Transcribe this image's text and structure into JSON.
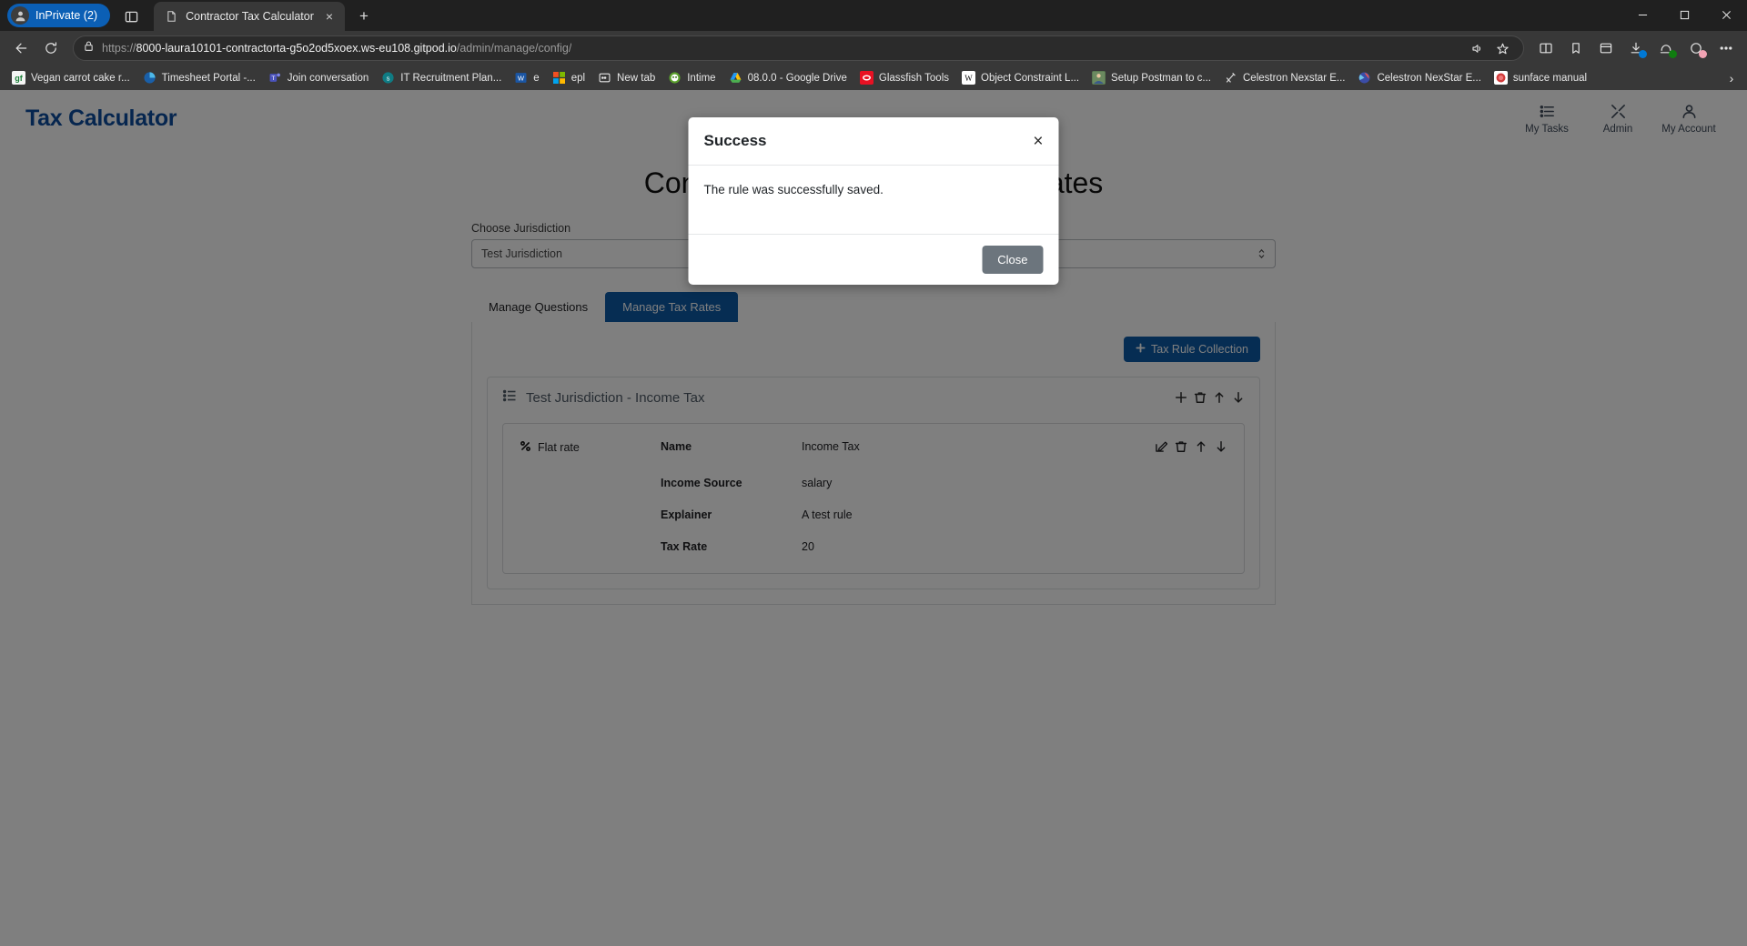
{
  "browser": {
    "profile_pill": "InPrivate (2)",
    "tab": {
      "title": "Contractor Tax Calculator",
      "close_label": "×"
    },
    "new_tab_label": "+",
    "url": {
      "scheme": "https://",
      "host": "8000-laura10101-contractorta-g5o2od5xoex.ws-eu108.gitpod.io",
      "path": "/admin/manage/config/"
    },
    "window_controls": {
      "minimize": "—",
      "maximize": "□",
      "close": "×"
    },
    "bookmarks": [
      {
        "label": "Vegan carrot cake r...",
        "icon": "gf-icon",
        "color": "#f5f5f5",
        "text": "gf",
        "textcolor": "#1a7f37"
      },
      {
        "label": "Timesheet Portal -...",
        "icon": "pie-icon",
        "color": "#1a5fa8",
        "text": "",
        "textcolor": "#fff"
      },
      {
        "label": "Join conversation",
        "icon": "teams-icon",
        "color": "#4b53bc",
        "text": "T",
        "textcolor": "#fff"
      },
      {
        "label": "IT Recruitment Plan...",
        "icon": "sharepoint-icon",
        "color": "#0f7c84",
        "text": "S",
        "textcolor": "#fff"
      },
      {
        "label": "e",
        "icon": "word-icon",
        "color": "#1b56a4",
        "text": "W",
        "textcolor": "#fff"
      },
      {
        "label": "epl",
        "icon": "microsoft-icon",
        "color": "#f25022",
        "text": "",
        "textcolor": "#fff"
      },
      {
        "label": "New tab",
        "icon": "newtab-icon",
        "color": "#ffffff",
        "text": "⬚",
        "textcolor": "#fff"
      },
      {
        "label": "Intime",
        "icon": "intime-icon",
        "color": "#5aa02c",
        "text": "♈",
        "textcolor": "#fff"
      },
      {
        "label": "08.0.0 - Google Drive",
        "icon": "google-drive-icon",
        "color": "#ffffff",
        "text": "△",
        "textcolor": "#2196f3"
      },
      {
        "label": "Glassfish Tools",
        "icon": "glassfish-icon",
        "color": "#e81123",
        "text": "○",
        "textcolor": "#fff"
      },
      {
        "label": "Object Constraint L...",
        "icon": "wikipedia-icon",
        "color": "#ffffff",
        "text": "W",
        "textcolor": "#111"
      },
      {
        "label": "Setup Postman to c...",
        "icon": "photo-icon",
        "color": "#5a7a52",
        "text": "",
        "textcolor": "#fff"
      },
      {
        "label": "Celestron Nexstar E...",
        "icon": "telescope-icon",
        "color": "#383838",
        "text": "☈",
        "textcolor": "#ddd"
      },
      {
        "label": "Celestron NexStar E...",
        "icon": "camera-shutter-icon",
        "color": "#3b4da8",
        "text": "◉",
        "textcolor": "#fff"
      },
      {
        "label": "sunface manual",
        "icon": "sunface-icon",
        "color": "#ffffff",
        "text": "✸",
        "textcolor": "#d23c3c"
      }
    ],
    "bookmarks_overflow": "›"
  },
  "app": {
    "brand": "Tax Calculator",
    "nav": [
      {
        "label": "My Tasks",
        "icon": "tasks-icon"
      },
      {
        "label": "Admin",
        "icon": "tools-icon"
      },
      {
        "label": "My Account",
        "icon": "user-icon"
      }
    ],
    "page_title": "Configure Questions and Tax Rates",
    "jurisdiction": {
      "label": "Choose Jurisdiction",
      "selected": "Test Jurisdiction"
    },
    "tabs": [
      {
        "label": "Manage Questions",
        "active": false
      },
      {
        "label": "Manage Tax Rates",
        "active": true
      }
    ],
    "add_collection_button": "Tax Rule Collection",
    "add_collection_icon": "plus-icon",
    "collection": {
      "title": "Test Jurisdiction - Income Tax",
      "icon": "list-ordered-icon",
      "actions": [
        {
          "name": "add-icon",
          "glyph": "+"
        },
        {
          "name": "trash-icon",
          "glyph": "🗑"
        },
        {
          "name": "arrow-up-icon",
          "glyph": "↑"
        },
        {
          "name": "arrow-down-icon",
          "glyph": "↓"
        }
      ]
    },
    "rule": {
      "type_label": "Flat rate",
      "type_icon": "percent-icon",
      "fields": [
        {
          "key": "Name",
          "value": "Income Tax"
        },
        {
          "key": "Income Source",
          "value": "salary"
        },
        {
          "key": "Explainer",
          "value": "A test rule"
        },
        {
          "key": "Tax Rate",
          "value": "20"
        }
      ],
      "actions": [
        {
          "name": "edit-icon",
          "glyph": "✎"
        },
        {
          "name": "trash-icon",
          "glyph": "🗑"
        },
        {
          "name": "arrow-up-icon",
          "glyph": "↑"
        },
        {
          "name": "arrow-down-icon",
          "glyph": "↓"
        }
      ]
    }
  },
  "modal": {
    "title": "Success",
    "close_x": "×",
    "message": "The rule was successfully saved.",
    "close_button": "Close"
  },
  "colors": {
    "brand_blue": "#0d4d9e",
    "accent_blue": "#0d5aa7",
    "secondary_gray": "#6c757d",
    "inprivate_blue": "#0b5fb5"
  }
}
